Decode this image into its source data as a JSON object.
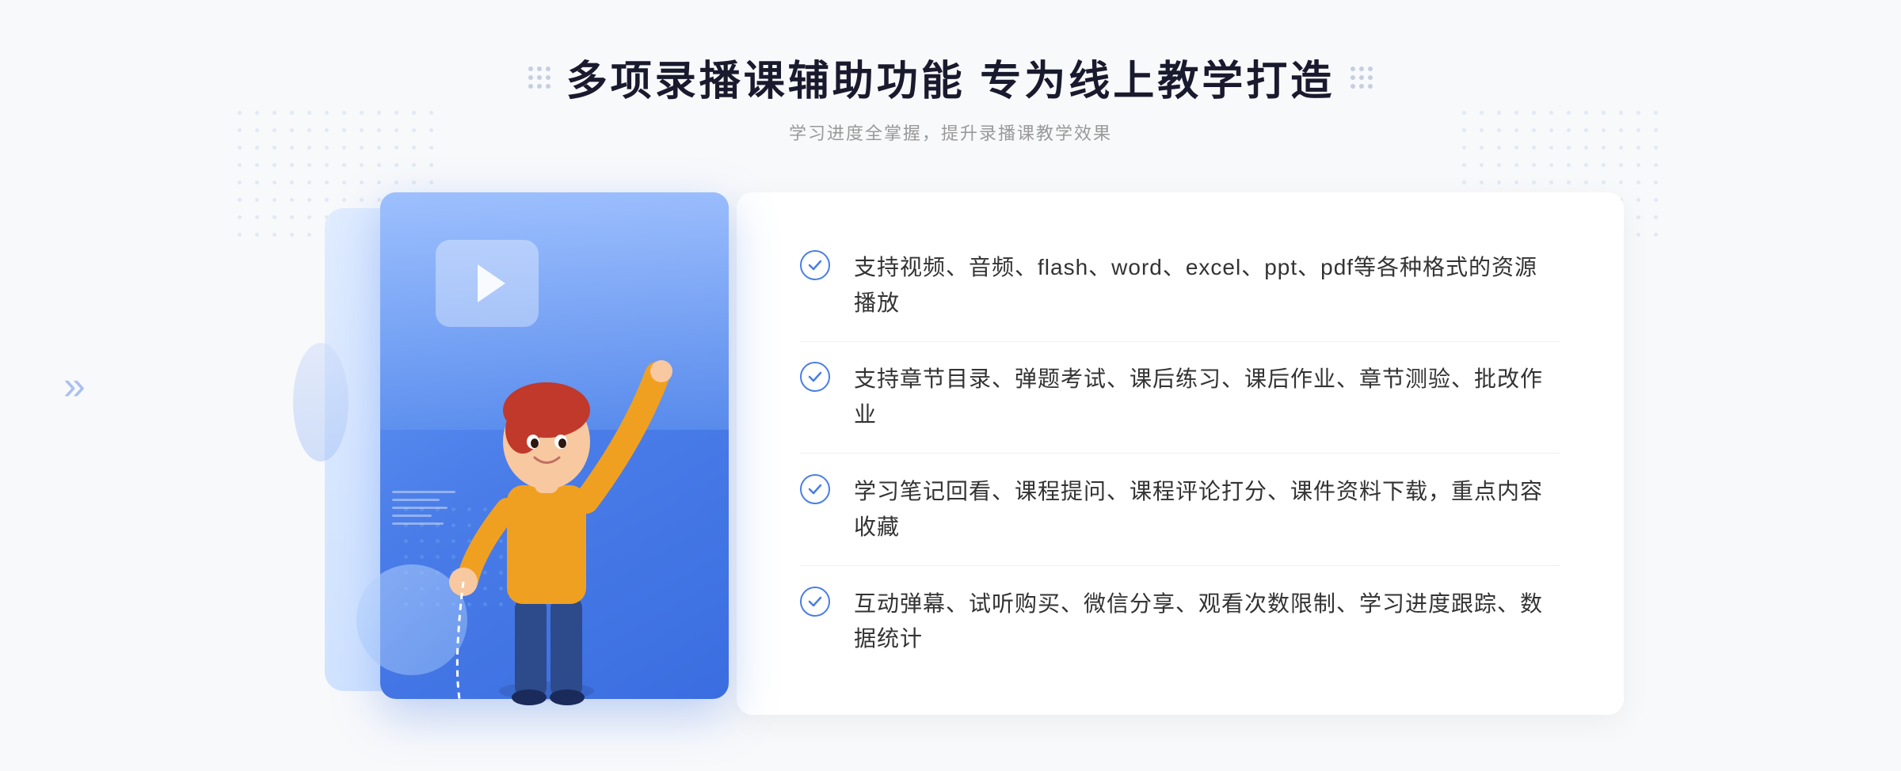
{
  "header": {
    "title": "多项录播课辅助功能 专为线上教学打造",
    "subtitle": "学习进度全掌握，提升录播课教学效果"
  },
  "features": [
    {
      "id": "feature-1",
      "text": "支持视频、音频、flash、word、excel、ppt、pdf等各种格式的资源播放"
    },
    {
      "id": "feature-2",
      "text": "支持章节目录、弹题考试、课后练习、课后作业、章节测验、批改作业"
    },
    {
      "id": "feature-3",
      "text": "学习笔记回看、课程提问、课程评论打分、课件资料下载，重点内容收藏"
    },
    {
      "id": "feature-4",
      "text": "互动弹幕、试听购买、微信分享、观看次数限制、学习进度跟踪、数据统计"
    }
  ],
  "decorations": {
    "left_arrow": "»",
    "check_symbol": "✓"
  }
}
